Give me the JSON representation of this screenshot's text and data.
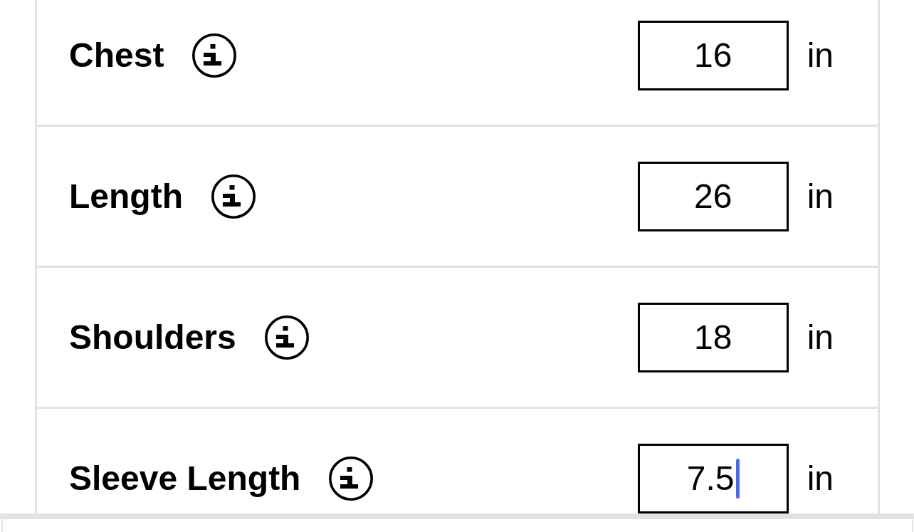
{
  "measurements": [
    {
      "label": "Chest",
      "value": "16",
      "unit": "in",
      "focused": false
    },
    {
      "label": "Length",
      "value": "26",
      "unit": "in",
      "focused": false
    },
    {
      "label": "Shoulders",
      "value": "18",
      "unit": "in",
      "focused": false
    },
    {
      "label": "Sleeve Length",
      "value": "7.5",
      "unit": "in",
      "focused": true
    }
  ]
}
